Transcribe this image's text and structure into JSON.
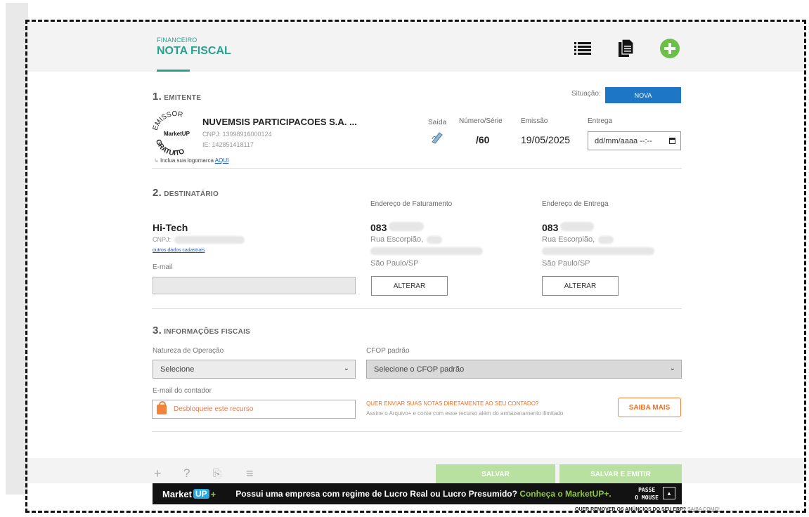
{
  "header": {
    "breadcrumb": "FINANCEIRO",
    "title": "NOTA FISCAL",
    "icons": [
      "list-icon",
      "document-icon",
      "add-icon"
    ],
    "accent_color": "#2aa08e",
    "add_color": "#6cc04a"
  },
  "emitente": {
    "section_num": "1.",
    "section_title": "EMITENTE",
    "status_label": "Situação:",
    "status_value": "NOVA",
    "company_name": "NUVEMSIS PARTICIPACOES S.A. ...",
    "cnpj": "CNPJ: 13998916000124",
    "ie": "IE: 142851418117",
    "logo_hint": "Inclua sua logomarca",
    "logo_hint_link": "AQUI",
    "seal_text_top": "EMISSOR",
    "seal_text_bottom": "GRATUITO",
    "seal_brand": "MarketUP",
    "col_saida": "Saída",
    "col_numero": "Número/Série",
    "col_emissao": "Emissão",
    "col_entrega": "Entrega",
    "numero_value": "/60",
    "emissao_value": "19/05/2025",
    "entrega_placeholder": "dd/mm/aaaa --:--"
  },
  "destinatario": {
    "section_num": "2.",
    "section_title": "DESTINATÁRIO",
    "name": "Hi-Tech",
    "cnpj_label": "CNPJ:",
    "other_data_link": "outros dados cadastrais",
    "email_label": "E-mail",
    "billing": {
      "label": "Endereço de Faturamento",
      "code": "083",
      "street": "Rua Escorpião,",
      "city": "São Paulo/SP",
      "button": "ALTERAR"
    },
    "delivery": {
      "label": "Endereço de Entrega",
      "code": "083",
      "street": "Rua Escorpião,",
      "city": "São Paulo/SP",
      "button": "ALTERAR"
    }
  },
  "fiscal": {
    "section_num": "3.",
    "section_title": "INFORMAÇÕES FISCAIS",
    "natureza_label": "Natureza de Operação",
    "natureza_value": "Selecione",
    "cfop_label": "CFOP padrão",
    "cfop_value": "Selecione o CFOP padrão",
    "email_contador_label": "E-mail do contador",
    "email_contador_locked": "Desbloqueie este recurso",
    "promo_title": "QUER ENVIAR SUAS NOTAS DIRETAMENTE AO SEU CONTADO?",
    "promo_sub": "Assine o Arquivo+ e conte com esse recurso além do armazenamento ilimitado",
    "promo_button": "SAIBA MAIS"
  },
  "footer": {
    "tool_add": "+",
    "tool_help": "?",
    "tool_copy": "⎘",
    "tool_menu": "≡",
    "save": "SALVAR",
    "save_emit": "SALVAR E EMITIR"
  },
  "ad": {
    "brand": "Market",
    "brand_up": "UP",
    "brand_plus": "+",
    "text": "Possui uma empresa com regime de Lucro Real ou Lucro Presumido?",
    "highlight": "Conheça o MarketUP+.",
    "pause_line1": "PASSE",
    "pause_line2": "O MOUSE",
    "arrow": "▲",
    "remove_text": "QUER REMOVER OS ANÚNCIOS DO SEU ERP?",
    "remove_link": "SAIBA COMO!"
  }
}
